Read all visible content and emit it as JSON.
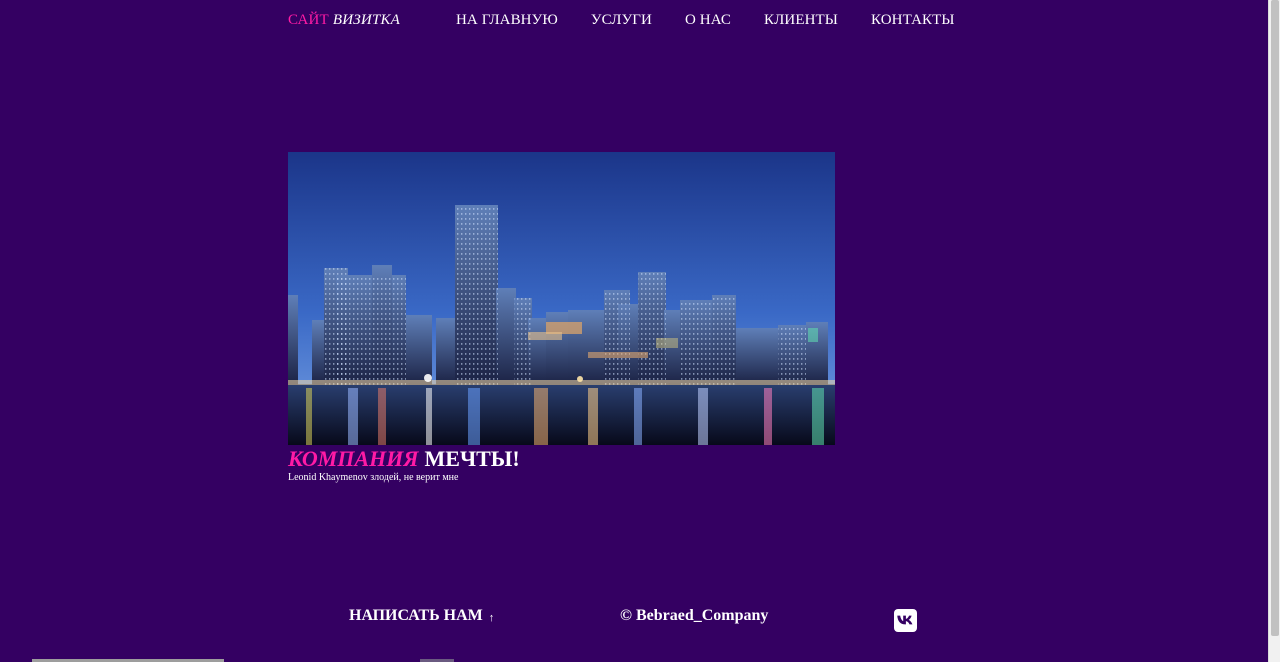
{
  "header": {
    "logo_part1": "САЙТ",
    "logo_part2": "ВИЗИТКА",
    "nav": [
      {
        "label": "НА ГЛАВНУЮ"
      },
      {
        "label": "УСЛУГИ"
      },
      {
        "label": "О НАС"
      },
      {
        "label": "КЛИЕНТЫ"
      },
      {
        "label": "КОНТАКТЫ"
      }
    ]
  },
  "hero": {
    "image_icon": "city-skyline-image",
    "title_part1": "КОМПАНИЯ",
    "title_part2": "МЕЧТЫ!",
    "subtitle": "Leonid Khaymenov злодей, не верит мне"
  },
  "footer": {
    "contact_label": "НАПИСАТЬ НАМ",
    "contact_arrow": "↑",
    "copyright": "© Bebraed_Company",
    "social_icon": "vk-icon"
  },
  "colors": {
    "background": "#340062",
    "accent": "#ff1aa5",
    "text": "#ffffff"
  }
}
